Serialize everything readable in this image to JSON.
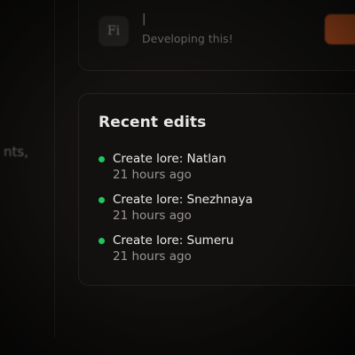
{
  "sidebar": {
    "fragment_text": "nts,"
  },
  "feed_post": {
    "avatar_initials": "Fi",
    "author": "|",
    "status": "Developing this!"
  },
  "recent_edits": {
    "title": "Recent edits",
    "status_color": "#22c55e",
    "items": [
      {
        "label": "Create lore: Natlan",
        "time": "21 hours ago"
      },
      {
        "label": "Create lore: Snezhnaya",
        "time": "21 hours ago"
      },
      {
        "label": "Create lore: Sumeru",
        "time": "21 hours ago"
      }
    ]
  },
  "colors": {
    "accent": "#c2521f",
    "background": "#100f0d",
    "card": "#121110"
  }
}
